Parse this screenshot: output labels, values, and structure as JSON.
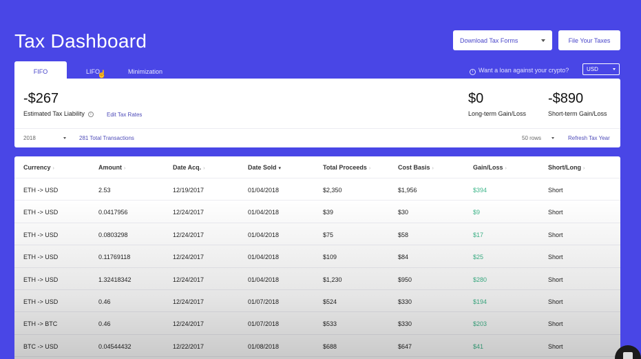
{
  "title": "Tax Dashboard",
  "header": {
    "download_label": "Download Tax Forms",
    "file_label": "File Your Taxes"
  },
  "tabs": [
    "FIFO",
    "LIFO",
    "Minimization"
  ],
  "loan_prompt": "Want a loan against your crypto?",
  "currency": "USD",
  "summary": {
    "tax_liability": "-$267",
    "tax_liability_label": "Estimated Tax Liability",
    "edit_rates": "Edit Tax Rates",
    "long_term_value": "$0",
    "long_term_label": "Long-term Gain/Loss",
    "short_term_value": "-$890",
    "short_term_label": "Short-term Gain/Loss",
    "year": "2018",
    "transactions": "281 Total Transactions",
    "rows_select": "50 rows",
    "refresh": "Refresh Tax Year"
  },
  "table": {
    "columns": [
      "Currency",
      "Amount",
      "Date Acq.",
      "Date Sold",
      "Total Proceeds",
      "Cost Basis",
      "Gain/Loss",
      "Short/Long"
    ],
    "rows": [
      [
        "ETH -> USD",
        "2.53",
        "12/19/2017",
        "01/04/2018",
        "$2,350",
        "$1,956",
        "$394",
        "Short"
      ],
      [
        "ETH -> USD",
        "0.0417956",
        "12/24/2017",
        "01/04/2018",
        "$39",
        "$30",
        "$9",
        "Short"
      ],
      [
        "ETH -> USD",
        "0.0803298",
        "12/24/2017",
        "01/04/2018",
        "$75",
        "$58",
        "$17",
        "Short"
      ],
      [
        "ETH -> USD",
        "0.11769118",
        "12/24/2017",
        "01/04/2018",
        "$109",
        "$84",
        "$25",
        "Short"
      ],
      [
        "ETH -> USD",
        "1.32418342",
        "12/24/2017",
        "01/04/2018",
        "$1,230",
        "$950",
        "$280",
        "Short"
      ],
      [
        "ETH -> USD",
        "0.46",
        "12/24/2017",
        "01/07/2018",
        "$524",
        "$330",
        "$194",
        "Short"
      ],
      [
        "ETH -> BTC",
        "0.46",
        "12/24/2017",
        "01/07/2018",
        "$533",
        "$330",
        "$203",
        "Short"
      ],
      [
        "BTC -> USD",
        "0.04544432",
        "12/22/2017",
        "01/08/2018",
        "$688",
        "$647",
        "$41",
        "Short"
      ]
    ]
  },
  "colors": {
    "background": "#4946e6",
    "accent": "#4744c9",
    "gain": "#3eb68a"
  }
}
